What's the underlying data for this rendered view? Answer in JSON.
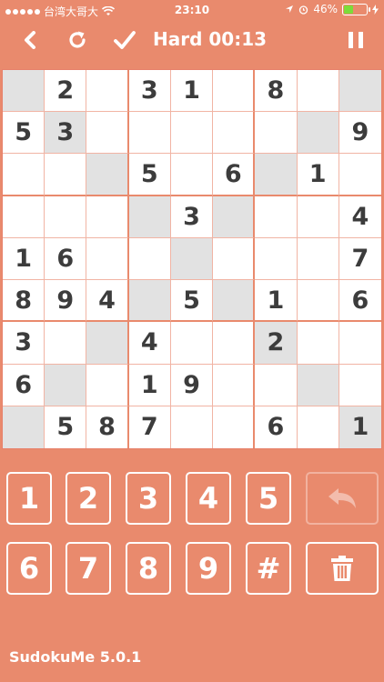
{
  "status_bar": {
    "carrier": "台湾大哥大",
    "time": "23:10",
    "battery_percent": "46%",
    "battery_level": 0.46
  },
  "toolbar": {
    "title": "Hard 00:13"
  },
  "board": {
    "rows": [
      [
        "",
        "2",
        "",
        "3",
        "1",
        "",
        "8",
        "",
        ""
      ],
      [
        "5",
        "3",
        "",
        "",
        "",
        "",
        "",
        "",
        "9"
      ],
      [
        "",
        "",
        "",
        "5",
        "",
        "6",
        "",
        "1",
        ""
      ],
      [
        "",
        "",
        "",
        "",
        "3",
        "",
        "",
        "",
        "4"
      ],
      [
        "1",
        "6",
        "",
        "",
        "",
        "",
        "",
        "",
        "7"
      ],
      [
        "8",
        "9",
        "4",
        "",
        "5",
        "",
        "1",
        "",
        "6"
      ],
      [
        "3",
        "",
        "",
        "4",
        "",
        "",
        "2",
        "",
        ""
      ],
      [
        "6",
        "",
        "",
        "1",
        "9",
        "",
        "",
        "",
        ""
      ],
      [
        "",
        "5",
        "8",
        "7",
        "",
        "",
        "6",
        "",
        "1"
      ]
    ],
    "shaded": [
      [
        0,
        0
      ],
      [
        0,
        8
      ],
      [
        1,
        1
      ],
      [
        1,
        7
      ],
      [
        2,
        2
      ],
      [
        2,
        6
      ],
      [
        3,
        3
      ],
      [
        3,
        5
      ],
      [
        4,
        4
      ],
      [
        5,
        3
      ],
      [
        5,
        5
      ],
      [
        6,
        2
      ],
      [
        6,
        6
      ],
      [
        7,
        1
      ],
      [
        7,
        7
      ],
      [
        8,
        0
      ],
      [
        8,
        8
      ]
    ]
  },
  "keypad": {
    "row1": [
      "1",
      "2",
      "3",
      "4",
      "5"
    ],
    "row2": [
      "6",
      "7",
      "8",
      "9",
      "#"
    ]
  },
  "footer": {
    "app_version": "SudokuMe 5.0.1"
  }
}
